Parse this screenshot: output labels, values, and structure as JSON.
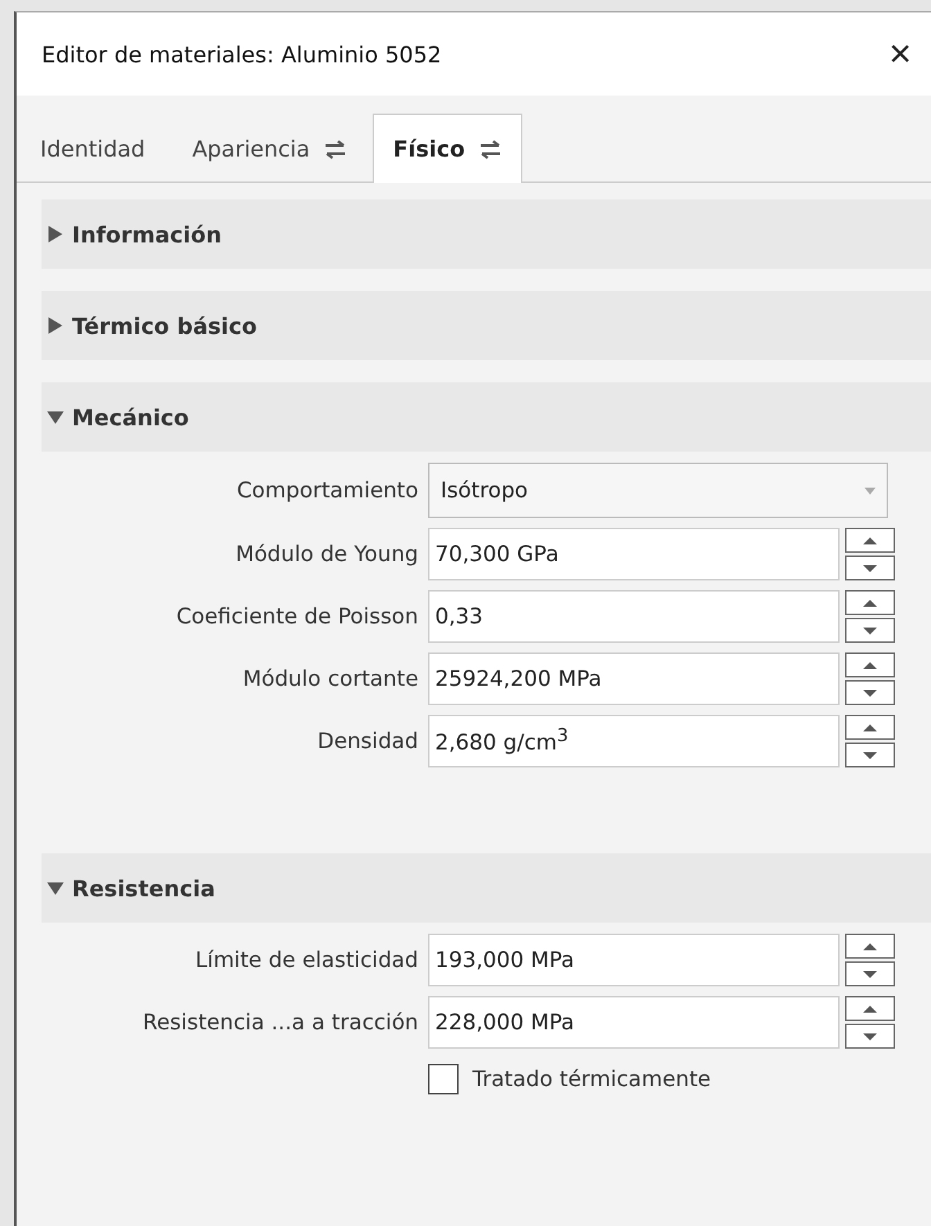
{
  "window": {
    "title": "Editor de materiales: Aluminio 5052",
    "close": "×"
  },
  "tabs": [
    {
      "label": "Identidad",
      "selected": false,
      "linked": false
    },
    {
      "label": "Apariencia",
      "selected": false,
      "linked": true
    },
    {
      "label": "Físico",
      "selected": true,
      "linked": true
    }
  ],
  "sections": [
    {
      "title": "Información",
      "expanded": false
    },
    {
      "title": "Térmico básico",
      "expanded": false
    },
    {
      "title": "Mecánico",
      "expanded": true,
      "rows": [
        {
          "kind": "combo",
          "label": "Comportamiento",
          "value": "Isótropo"
        },
        {
          "kind": "spin",
          "label": "Módulo de Young",
          "value": "70,300 GPa"
        },
        {
          "kind": "spin",
          "label": "Coeficiente de Poisson",
          "value": "0,33"
        },
        {
          "kind": "spin",
          "label": "Módulo cortante",
          "value": "25924,200 MPa"
        },
        {
          "kind": "spin",
          "label": "Densidad",
          "value": "2,680 g/cm$^{3}$"
        }
      ]
    },
    {
      "title": "Resistencia",
      "expanded": true,
      "rows": [
        {
          "kind": "spin",
          "label": "Límite de elasticidad",
          "value": "193,000 MPa"
        },
        {
          "kind": "spin",
          "label": "Resistencia ...a a tracción",
          "value": "228,000 MPa"
        },
        {
          "kind": "checkbox",
          "label": "Tratado térmicamente",
          "checked": false
        }
      ]
    }
  ]
}
